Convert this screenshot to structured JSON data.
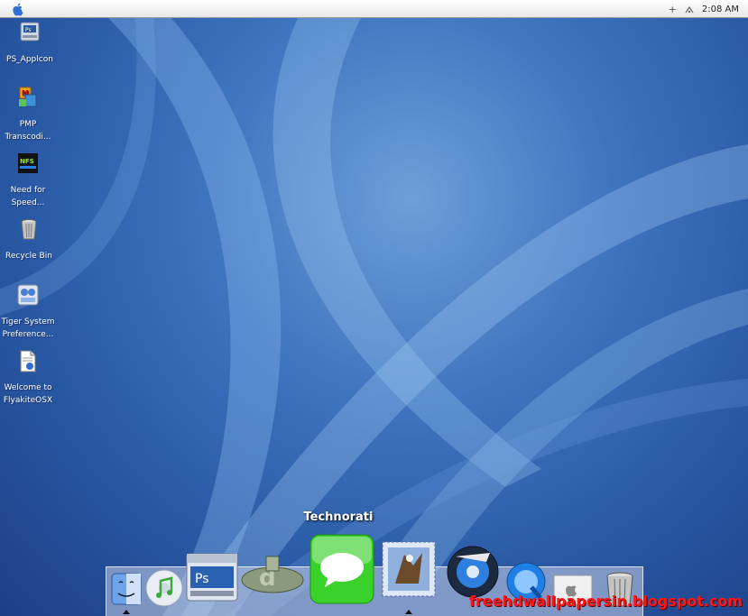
{
  "menubar": {
    "apple_icon": "apple-logo-icon",
    "clock": "2:08 AM",
    "status_icons": [
      "plus-icon",
      "wifi-icon"
    ]
  },
  "desktop_icons": [
    {
      "label_lines": [
        "PS_Applcon"
      ],
      "icon": "photoshop-drive-icon"
    },
    {
      "label_lines": [
        "PMP",
        "Transcodi..."
      ],
      "icon": "pmp-transcoder-icon"
    },
    {
      "label_lines": [
        "Need for",
        "Speed..."
      ],
      "icon": "need-for-speed-icon"
    },
    {
      "label_lines": [
        "Recycle Bin"
      ],
      "icon": "trash-icon"
    },
    {
      "label_lines": [
        "Tiger System",
        "Preference..."
      ],
      "icon": "system-preferences-icon"
    },
    {
      "label_lines": [
        "Welcome to",
        "FlyakiteOSX"
      ],
      "icon": "document-icon"
    }
  ],
  "dock": {
    "tooltip": "Technorati",
    "items": [
      "finder-icon",
      "itunes-icon",
      "photoshop-icon",
      "deviantart-icon",
      "technorati-icon",
      "mail-icon",
      "dvd-player-icon",
      "quicktime-icon",
      "apple-app-icon",
      "trash-icon"
    ]
  },
  "watermark": "freehdwallpapersin.blogspot.com",
  "colors": {
    "wallpaper": "#2a5aa6",
    "accent_green": "#3bd12b",
    "watermark": "#ff1616"
  }
}
